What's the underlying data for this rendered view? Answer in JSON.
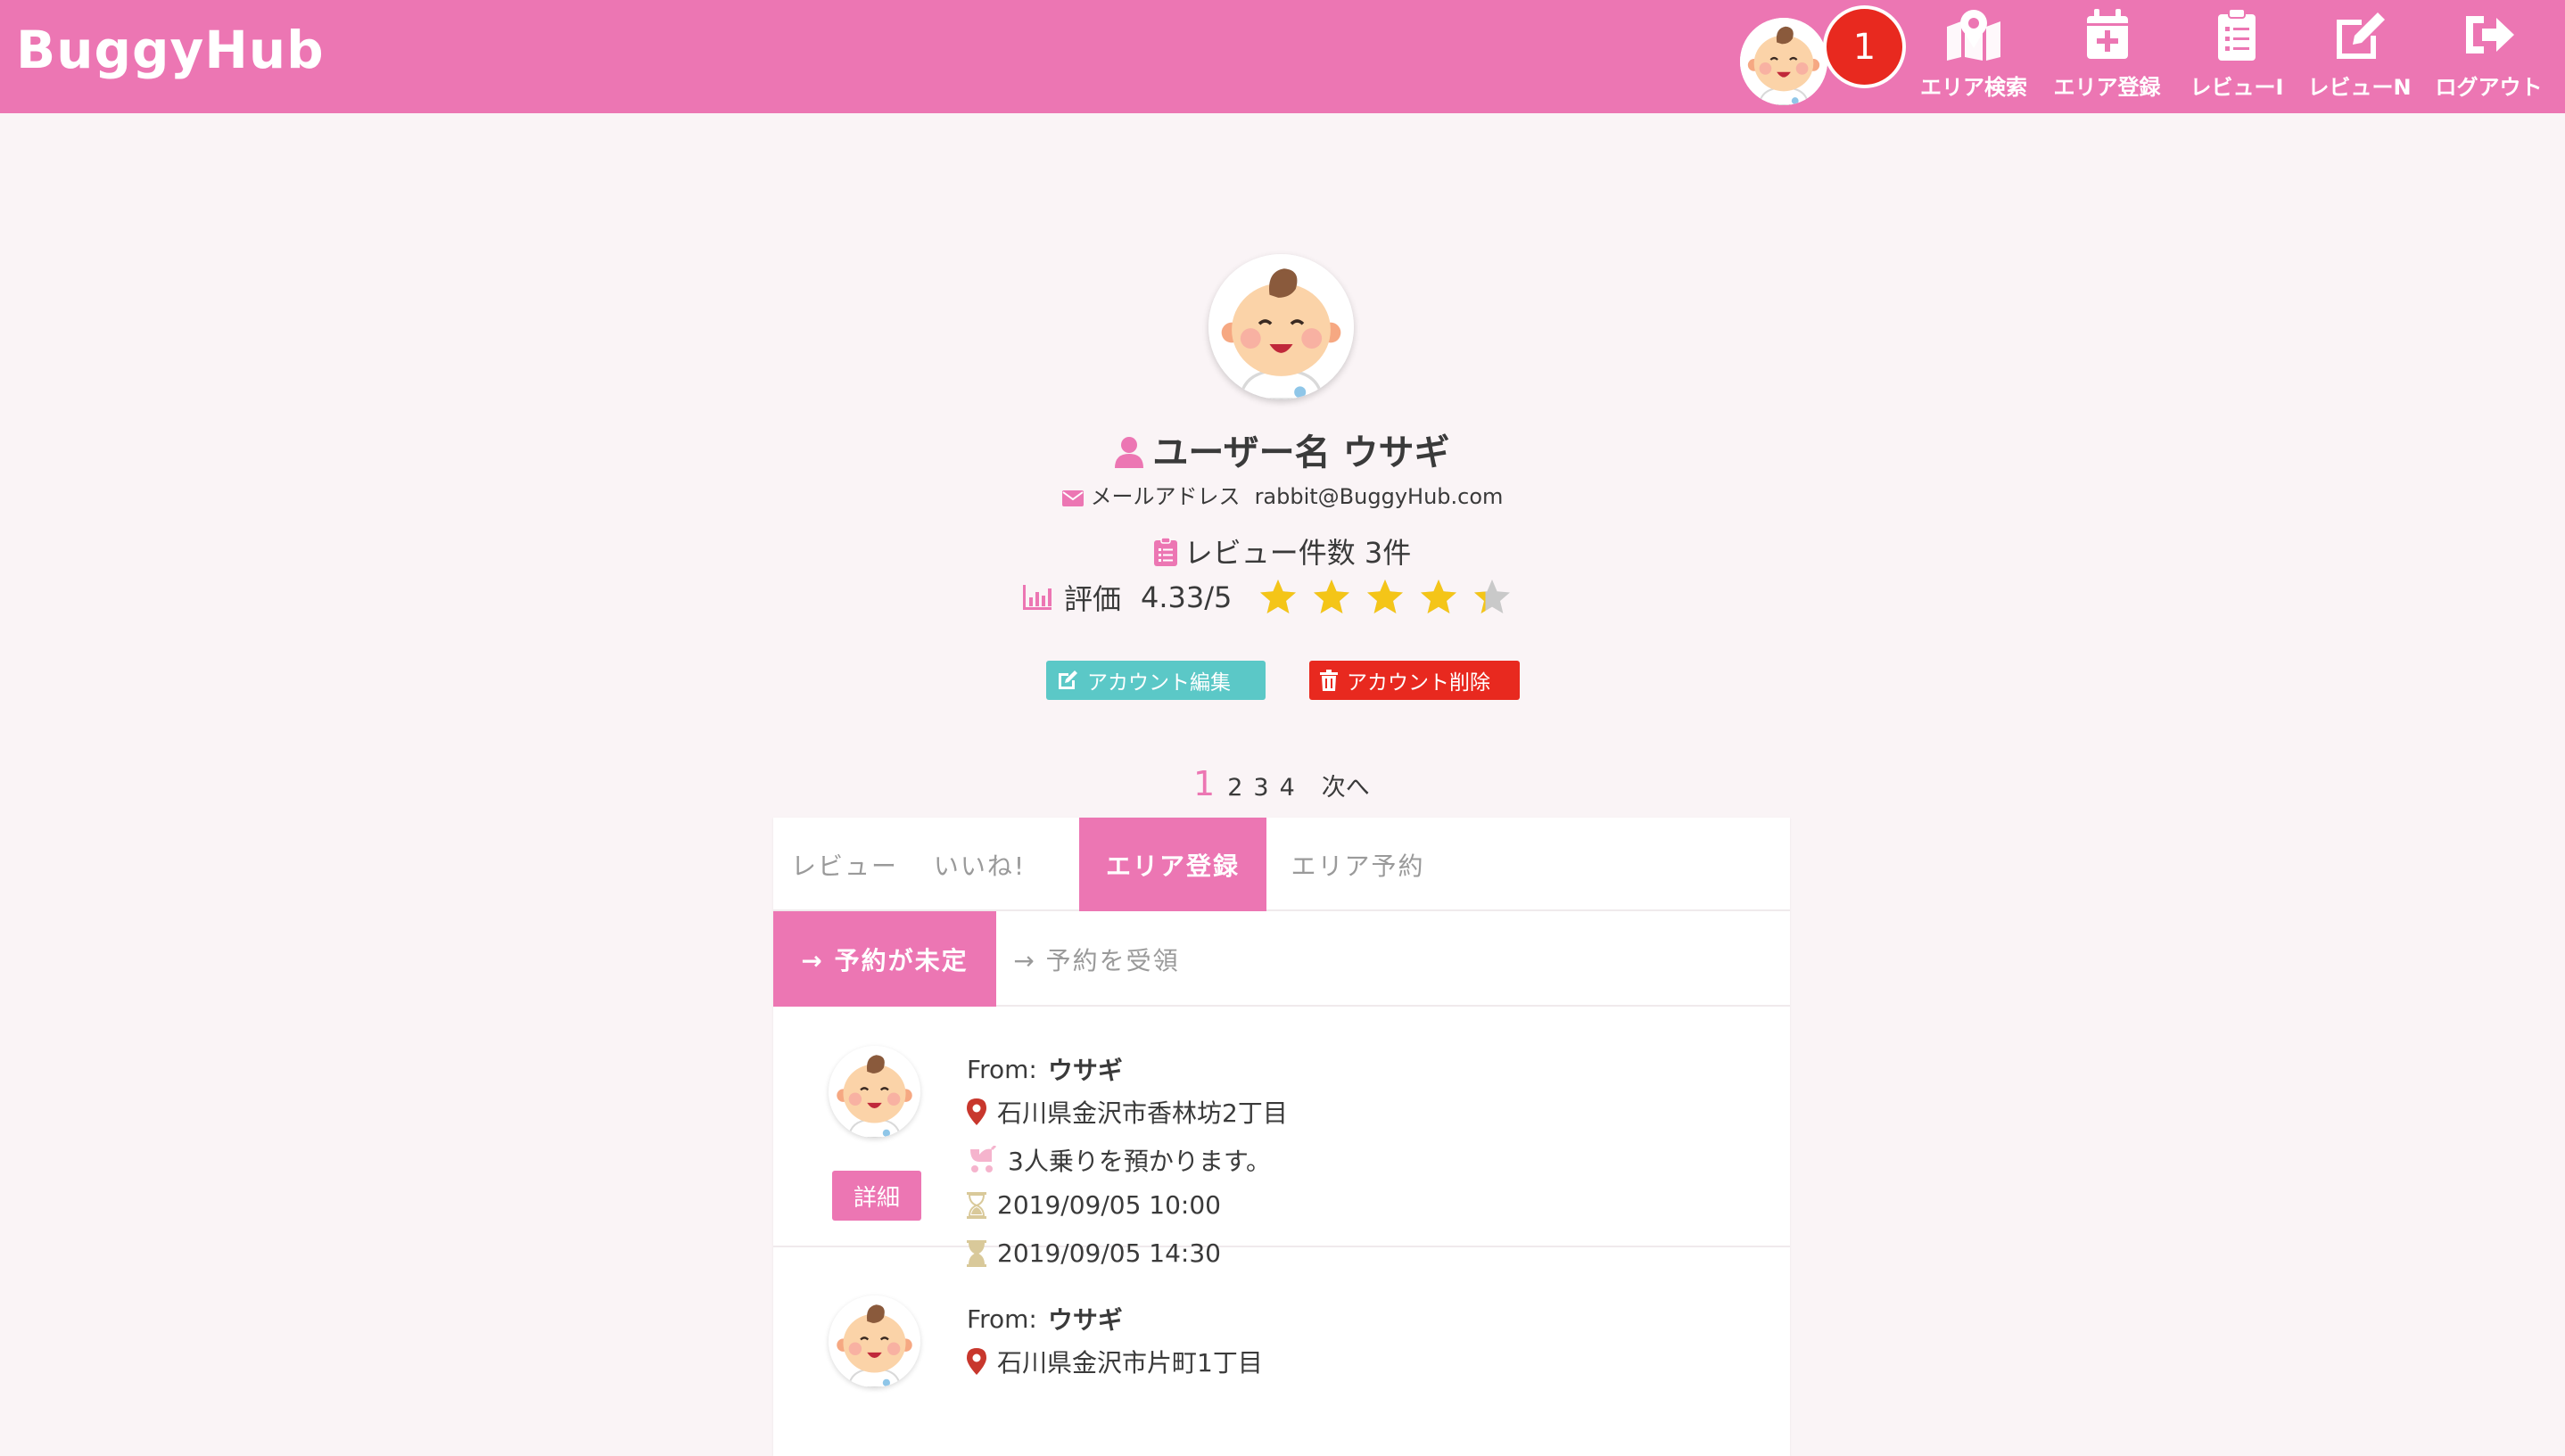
{
  "app": {
    "title": "BuggyHub"
  },
  "nav": {
    "notification_count": "1",
    "items": [
      {
        "label": "エリア検索",
        "icon": "map-marker-icon"
      },
      {
        "label": "エリア登録",
        "icon": "calendar-plus-icon"
      },
      {
        "label": "レビューI",
        "icon": "clipboard-list-icon"
      },
      {
        "label": "レビューN",
        "icon": "edit-icon"
      },
      {
        "label": "ログアウト",
        "icon": "sign-out-icon"
      }
    ]
  },
  "profile": {
    "name": "ユーザー名 ウサギ",
    "email_label": "メールアドレス",
    "email": "rabbit@BuggyHub.com",
    "review_count": "レビュー件数 3件",
    "rating_label": "評価",
    "rating_value": "4.33/5",
    "rating_fraction": 0.866,
    "edit_label": "アカウント編集",
    "delete_label": "アカウント削除"
  },
  "pagination": {
    "current": "1",
    "pages": [
      "2",
      "3",
      "4"
    ],
    "next": "次へ"
  },
  "tabs": [
    {
      "label": "レビュー",
      "active": false
    },
    {
      "label": "いいね!",
      "active": false
    },
    {
      "label": "エリア登録",
      "active": true
    },
    {
      "label": "エリア予約",
      "active": false
    }
  ],
  "subtabs": [
    {
      "label": "→ 予約が未定",
      "active": true
    },
    {
      "label": "→ 予約を受領",
      "active": false
    }
  ],
  "reservations": [
    {
      "from_label": "From:",
      "from_name": "ウサギ",
      "address": "石川県金沢市香林坊2丁目",
      "note": "3人乗りを預かります。",
      "start": "2019/09/05 10:00",
      "end": "2019/09/05 14:30",
      "detail_label": "詳細"
    },
    {
      "from_label": "From:",
      "from_name": "ウサギ",
      "address": "石川県金沢市片町1丁目"
    }
  ],
  "colors": {
    "brand": "#ec76b3",
    "teal": "#5bc8c7",
    "danger": "#e8291f",
    "star": "#f4c518"
  }
}
